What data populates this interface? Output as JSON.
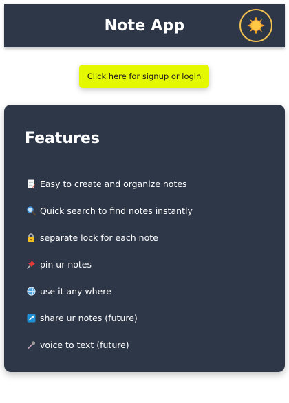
{
  "header": {
    "title": "Note App",
    "theme_icon": "sun-icon"
  },
  "auth": {
    "button_label": "Click here for signup or login"
  },
  "features": {
    "title": "Features",
    "items": [
      {
        "icon": "memo-icon",
        "label": "Easy to create and organize notes"
      },
      {
        "icon": "magnifier-icon",
        "label": "Quick search to find notes instantly"
      },
      {
        "icon": "lock-icon",
        "label": "separate lock for each note"
      },
      {
        "icon": "pushpin-icon",
        "label": "pin ur notes"
      },
      {
        "icon": "globe-icon",
        "label": "use it any where"
      },
      {
        "icon": "share-arrow-icon",
        "label": "share ur notes (future)"
      },
      {
        "icon": "microphone-icon",
        "label": "voice to text (future)"
      }
    ]
  },
  "colors": {
    "panel": "#2e3748",
    "button": "#e4f800",
    "sun": "#f6b83a"
  }
}
